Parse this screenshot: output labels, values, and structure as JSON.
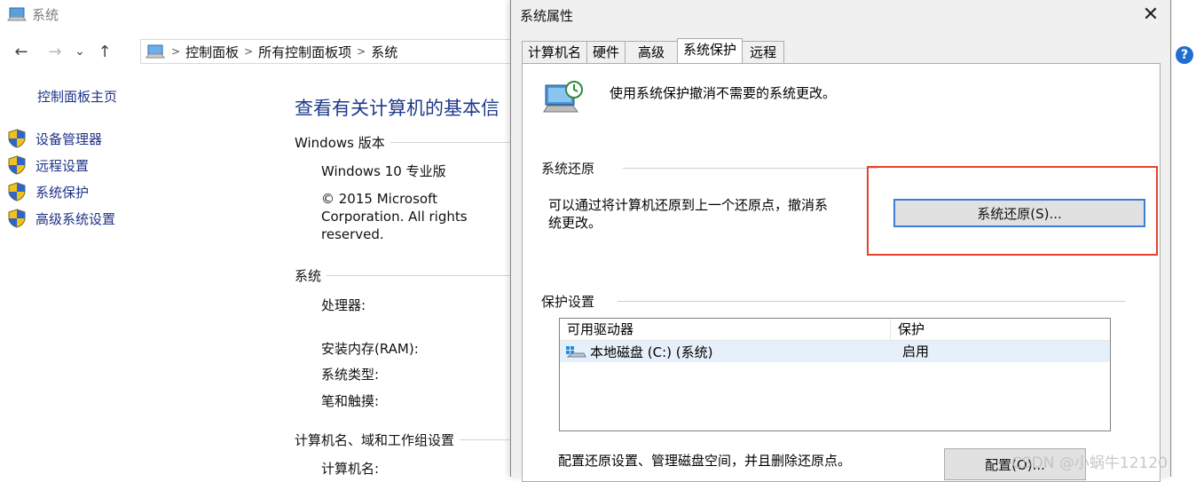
{
  "bg_window": {
    "title": "系统",
    "nav": {
      "back": "←",
      "forward": "→",
      "dropdown": "⌄",
      "up": "↑"
    },
    "breadcrumb": [
      "控制面板",
      "所有控制面板项",
      "系统"
    ],
    "sidebar": {
      "home": "控制面板主页",
      "items": [
        {
          "label": "设备管理器"
        },
        {
          "label": "远程设置"
        },
        {
          "label": "系统保护"
        },
        {
          "label": "高级系统设置"
        }
      ]
    },
    "heading": "查看有关计算机的基本信",
    "windows_edition": {
      "section": "Windows 版本",
      "name": "Windows 10 专业版",
      "copyright": "© 2015 Microsoft Corporation. All rights reserved."
    },
    "system": {
      "section": "系统",
      "processor_label": "处理器:",
      "ram_label": "安装内存(RAM):",
      "type_label": "系统类型:",
      "pen_label": "笔和触摸:"
    },
    "computer_name": {
      "section": "计算机名、域和工作组设置",
      "name_label": "计算机名:"
    }
  },
  "dialog": {
    "title": "系统属性",
    "close": "✕",
    "tabs": [
      {
        "label": "计算机名",
        "active": false
      },
      {
        "label": "硬件",
        "active": false
      },
      {
        "label": "高级",
        "active": false
      },
      {
        "label": "系统保护",
        "active": true
      },
      {
        "label": "远程",
        "active": false
      }
    ],
    "intro": "使用系统保护撤消不需要的系统更改。",
    "restore": {
      "section": "系统还原",
      "desc_line1": "可以通过将计算机还原到上一个还原点，撤消系",
      "desc_line2": "统更改。",
      "button": "系统还原(S)..."
    },
    "protection": {
      "section": "保护设置",
      "columns": [
        "可用驱动器",
        "保护"
      ],
      "rows": [
        {
          "drive": "本地磁盘 (C:) (系统)",
          "status": "启用"
        }
      ]
    },
    "config": {
      "desc": "配置还原设置、管理磁盘空间，并且删除还原点。",
      "button": "配置(O)..."
    }
  },
  "right_edge": {
    "help": "?"
  },
  "watermark": "CSDN @小蜗牛12120",
  "colors": {
    "link": "#1e3287",
    "heading": "#1e3a8a",
    "highlight": "#e8412c",
    "focus": "#3c7fd6"
  }
}
